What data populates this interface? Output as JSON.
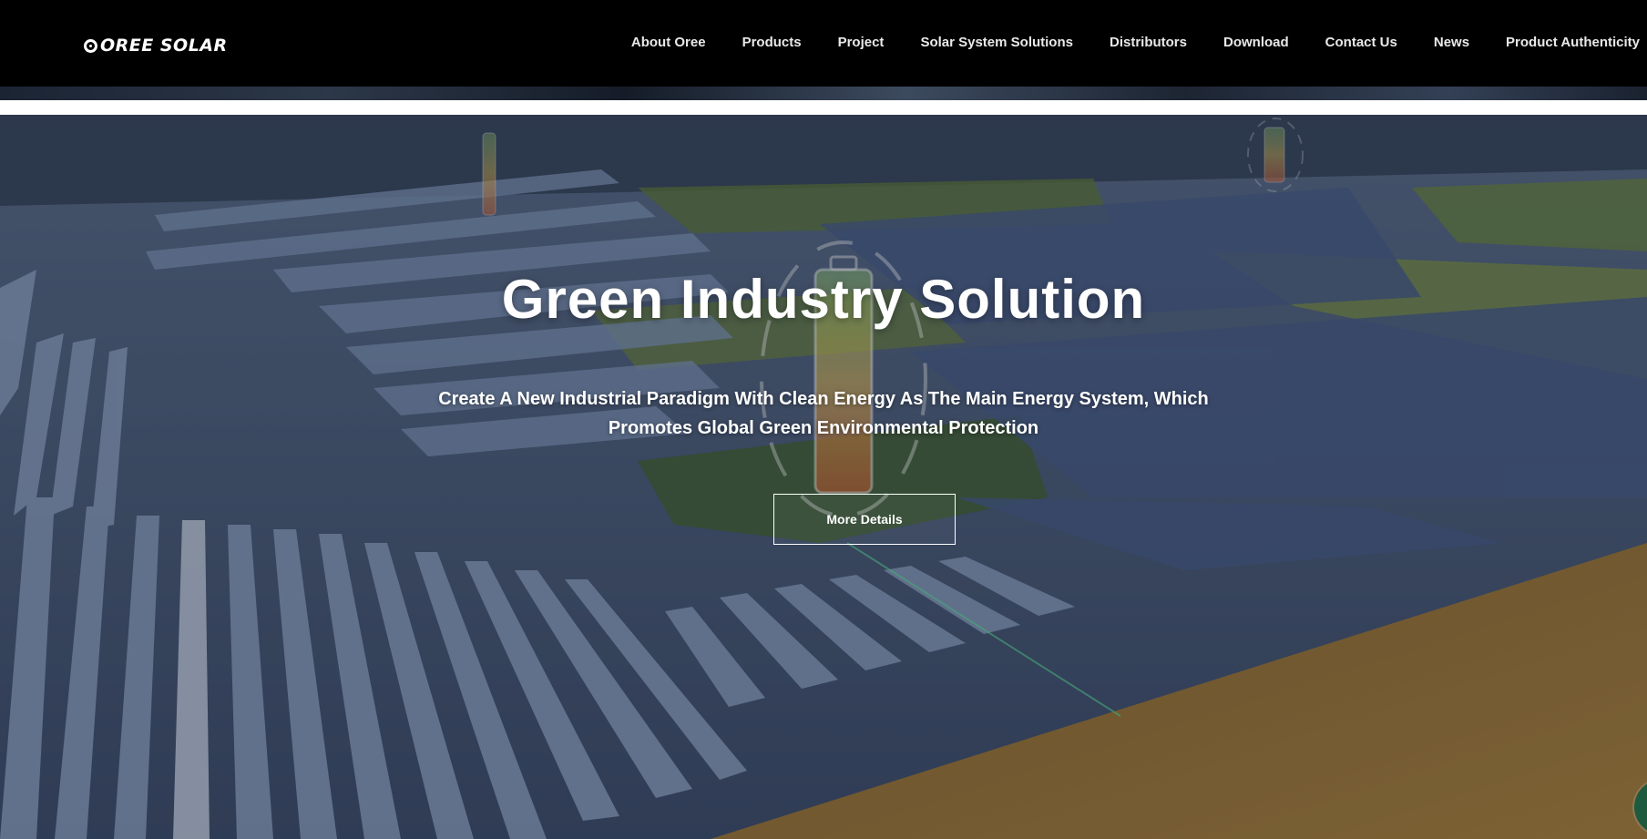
{
  "header": {
    "logo_text": "OREE SOLAR",
    "nav": [
      {
        "label": "About Oree"
      },
      {
        "label": "Products"
      },
      {
        "label": "Project"
      },
      {
        "label": "Solar System Solutions"
      },
      {
        "label": "Distributors"
      },
      {
        "label": "Download"
      },
      {
        "label": "Contact Us"
      },
      {
        "label": "News"
      },
      {
        "label": "Product Authenticity"
      }
    ]
  },
  "hero": {
    "title": "Green Industry Solution",
    "subtitle": "Create A New Industrial Paradigm With Clean Energy As The Main Energy System, Which Promotes Global Green Environmental Protection",
    "button_label": "More Details",
    "background_image": "solar-farm-aerial-photo"
  },
  "widgets": {
    "chat_icon": "chat-bubble-icon"
  },
  "colors": {
    "header_bg": "#000000",
    "hero_text": "#ffffff",
    "chat_bubble": "#1e5a3e"
  }
}
